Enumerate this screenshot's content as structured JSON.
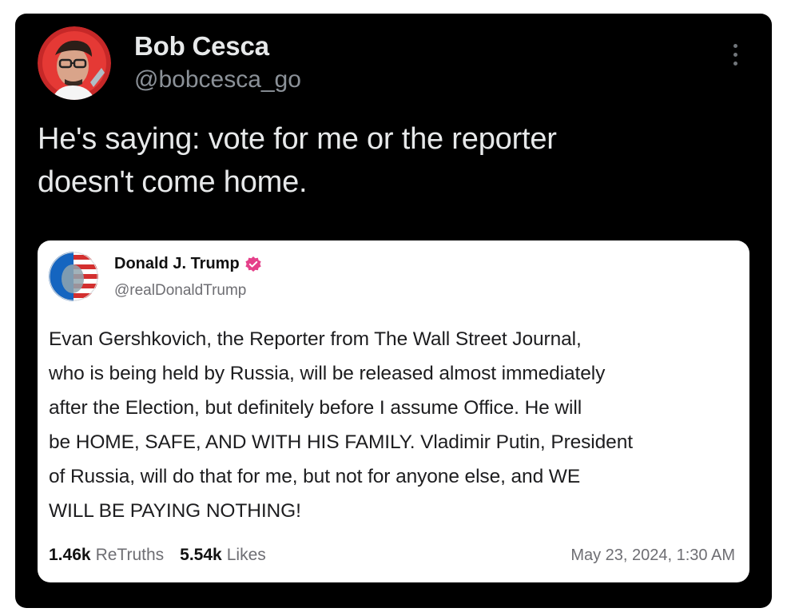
{
  "post": {
    "author_name": "Bob Cesca",
    "author_handle": "@bobcesca_go",
    "text_line1": "He's saying: vote for me or the reporter",
    "text_line2": "doesn't come home."
  },
  "quoted_post": {
    "author_name": "Donald J. Trump",
    "author_handle": "@realDonaldTrump",
    "lines": [
      "Evan Gershkovich, the Reporter from The Wall Street Journal,",
      "who is being held by Russia, will be released almost immediately",
      "after the Election, but definitely before I assume Office. He will",
      "be HOME, SAFE, AND WITH HIS FAMILY. Vladimir Putin, President",
      "of Russia, will do that for me, but not for anyone else, and WE",
      "WILL BE PAYING NOTHING!"
    ],
    "retruths_count": "1.46k",
    "retruths_label": "ReTruths",
    "likes_count": "5.54k",
    "likes_label": "Likes",
    "timestamp": "May 23, 2024, 1:30 AM"
  },
  "colors": {
    "card_background": "#000000",
    "quote_background": "#ffffff",
    "verified_badge": "#e5408a"
  },
  "icons": {
    "more": "more-options-icon",
    "verified": "verified-badge-icon"
  }
}
